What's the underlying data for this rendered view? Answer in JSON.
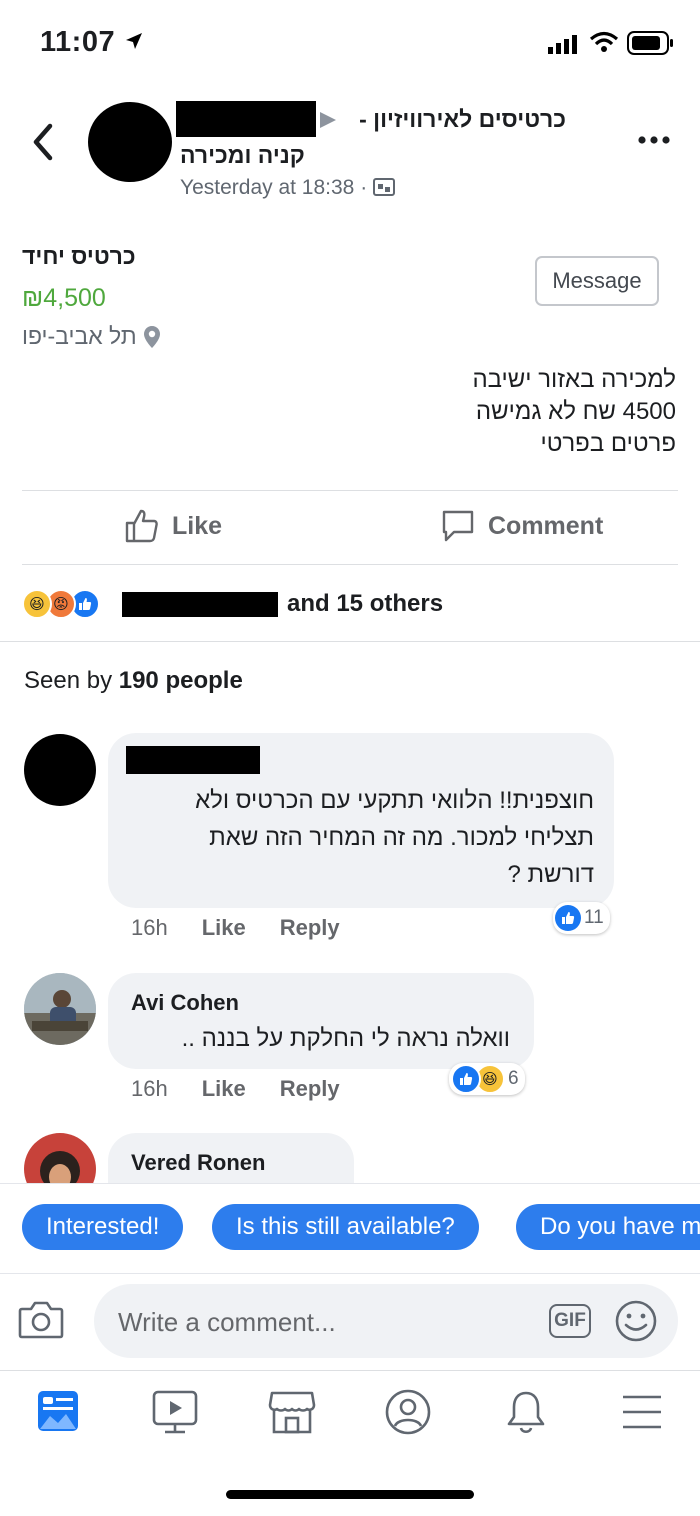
{
  "status_bar": {
    "time": "11:07"
  },
  "post": {
    "group_name": "כרטיסים לאירוויזיון - קניה ומכירה",
    "group_name_line1": "כרטיסים לאירוויזיון -",
    "group_name_line2": "קניה ומכירה",
    "timestamp": "Yesterday at 18:38 ·"
  },
  "listing": {
    "title": "כרטיס יחיד",
    "price": "₪4,500",
    "location": "תל אביב-יפו",
    "message_label": "Message",
    "description": [
      "למכירה באזור ישיבה",
      "4500 שח לא גמישה",
      "פרטים בפרטי"
    ]
  },
  "actions": {
    "like_label": "Like",
    "comment_label": "Comment"
  },
  "reactions_summary": {
    "others": "and 15 others"
  },
  "seen": {
    "prefix": "Seen by ",
    "count": "190 people"
  },
  "comments": [
    {
      "author": "",
      "text": [
        "חוצפנית!! הלוואי תתקעי עם הכרטיס ולא",
        "תצליחי למכור. מה זה המחיר הזה שאת",
        "דורשת ?"
      ],
      "time": "16h",
      "like": "Like",
      "reply": "Reply",
      "reaction_count": "11"
    },
    {
      "author": "Avi Cohen",
      "text": [
        "וואלה נראה לי החלקת על בננה .."
      ],
      "time": "16h",
      "like": "Like",
      "reply": "Reply",
      "reaction_count": "6"
    },
    {
      "author": "Vered Ronen"
    }
  ],
  "quick_replies": [
    "Interested!",
    "Is this still available?",
    "Do you have m"
  ],
  "composer": {
    "placeholder": "Write a comment...",
    "gif": "GIF"
  },
  "tabbar": {
    "icons": [
      "news-feed-icon",
      "watch-icon",
      "marketplace-icon",
      "profile-icon",
      "notifications-icon",
      "menu-icon"
    ]
  },
  "colors": {
    "accent": "#2d7ded",
    "price": "#4fa83d",
    "like_blue": "#1877f2"
  }
}
